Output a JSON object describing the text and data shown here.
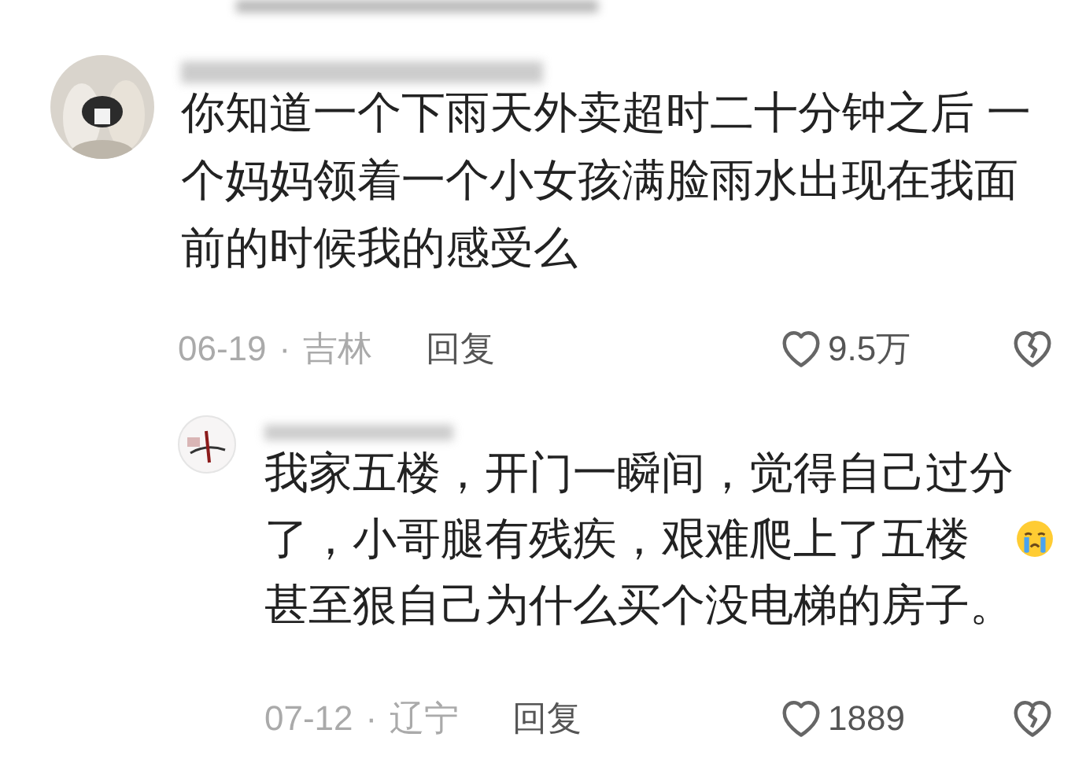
{
  "comments": [
    {
      "text": "你知道一个下雨天外卖超时二十分钟之后 一个妈妈领着一个小女孩满脸雨水出现在我面前的时候我的感受么",
      "date": "06-19",
      "separator": "·",
      "location": "吉林",
      "reply_label": "回复",
      "like_count": "9.5万",
      "replies": [
        {
          "text": "我家五楼，开门一瞬间，觉得自己过分了，小哥腿有残疾，艰难爬上了五楼",
          "text_end": "甚至狠自己为什么买个没电梯的房子。",
          "date": "07-12",
          "separator": "·",
          "location": "辽宁",
          "reply_label": "回复",
          "like_count": "1889"
        }
      ]
    }
  ]
}
